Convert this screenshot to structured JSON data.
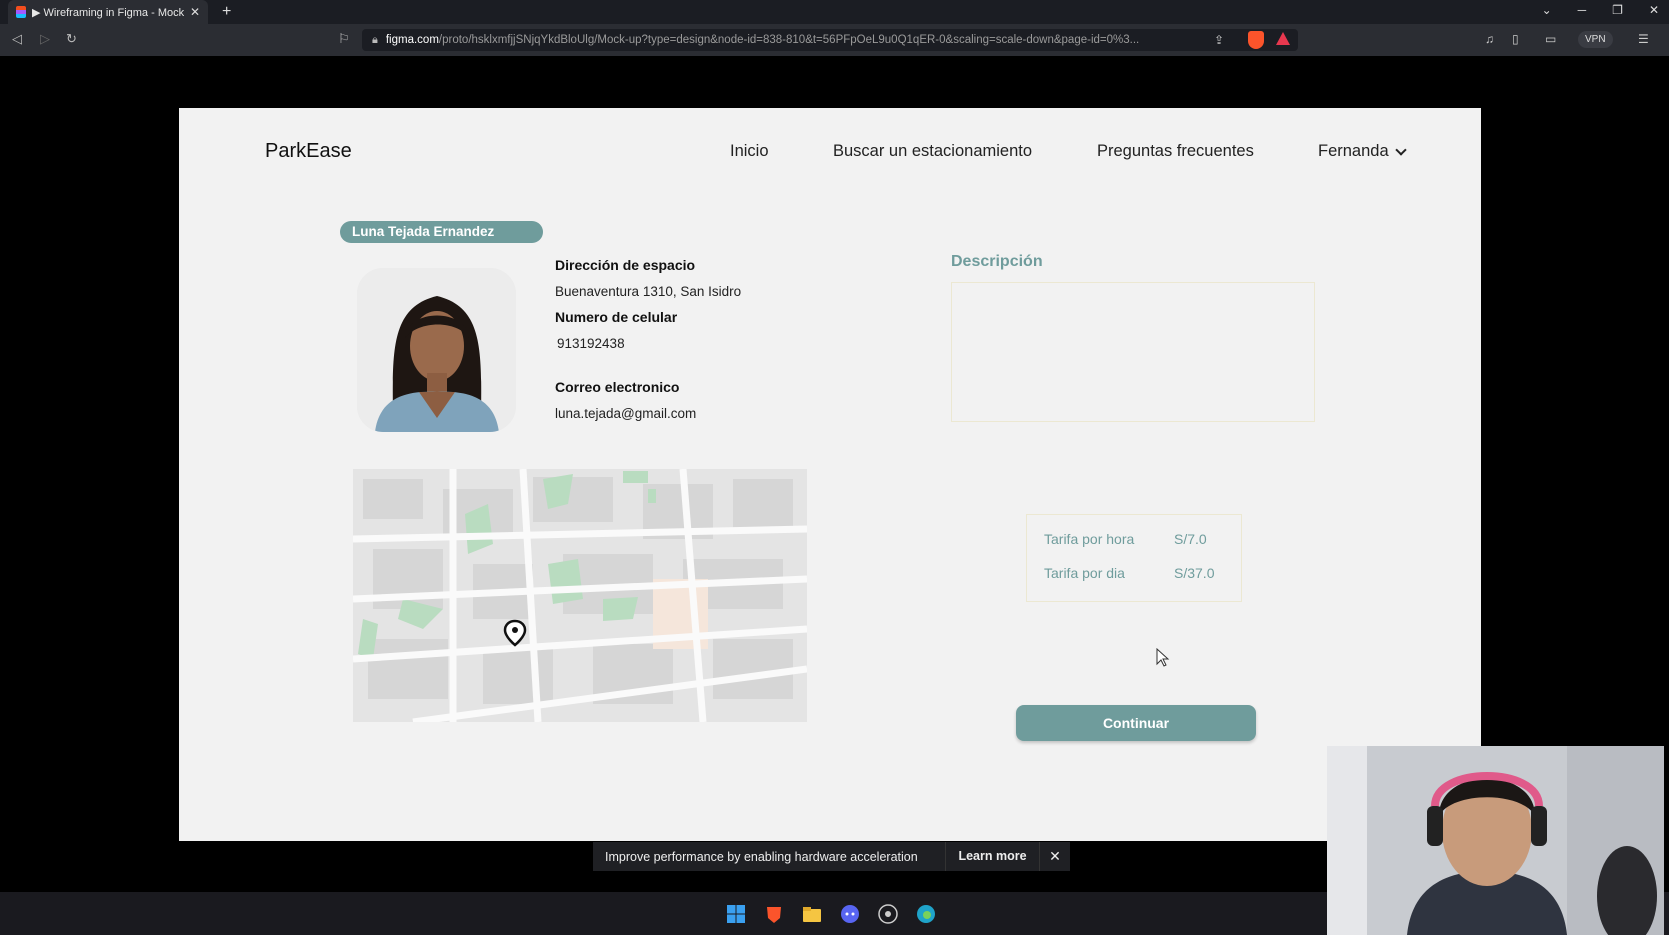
{
  "browser": {
    "tab_title": "▶ Wireframing in Figma - Mock-",
    "url_host": "figma.com",
    "url_path": "/proto/hsklxmfjjSNjqYkdBloUlg/Mock-up?type=design&node-id=838-810&t=56PFpOeL9u0Q1qER-0&scaling=scale-down&page-id=0%3...",
    "vpn_label": "VPN",
    "icons": [
      "back-icon",
      "forward-icon",
      "reload-icon",
      "bookmark-icon",
      "lock-icon",
      "share-icon",
      "brave-shield-icon",
      "rewards-icon",
      "music-icon",
      "sidebar-icon",
      "wallet-icon",
      "menu-icon"
    ]
  },
  "app": {
    "logo": "ParkEase",
    "nav": {
      "inicio": "Inicio",
      "buscar": "Buscar un estacionamiento",
      "preguntas": "Preguntas frecuentes",
      "user": "Fernanda"
    }
  },
  "profile": {
    "name": "Luna Tejada Ernandez",
    "direccion_label": "Dirección de espacio",
    "direccion_value": "Buenaventura 1310, San Isidro",
    "celular_label": "Numero de celular",
    "celular_value": "913192438",
    "correo_label": "Correo electronico",
    "correo_value": "luna.tejada@gmail.com"
  },
  "descripcion": {
    "title": "Descripción",
    "text": ""
  },
  "rates": {
    "hora_label": "Tarifa por hora",
    "hora_value": "S/7.0",
    "dia_label": "Tarifa por dia",
    "dia_value": "S/37.0"
  },
  "actions": {
    "continue_label": "Continuar"
  },
  "notification": {
    "message": "Improve performance by enabling hardware acceleration",
    "learn_more": "Learn more"
  },
  "colors": {
    "accent": "#6f9c9c",
    "frame_bg": "#f2f2f2"
  }
}
